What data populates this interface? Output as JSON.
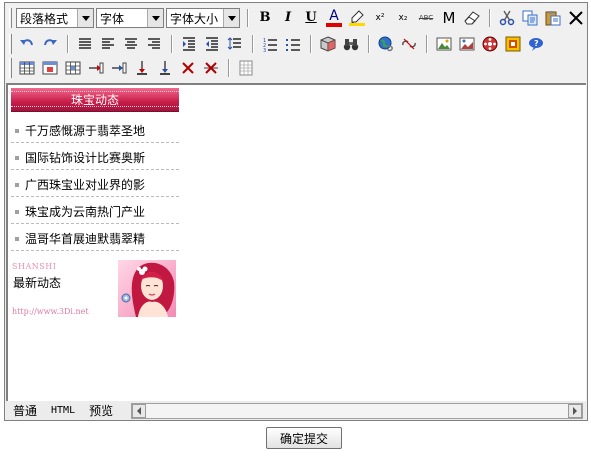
{
  "toolbar": {
    "paragraph_format": "段落格式",
    "font_family": "字体",
    "font_size": "字体大小",
    "bold_label": "B",
    "italic_label": "I",
    "underline_label": "U",
    "font_color_label": "A",
    "superscript_label": "x²",
    "subscript_label": "x₂",
    "spellcheck_label": "ABC",
    "marker_label": "M"
  },
  "content": {
    "news_header": "珠宝动态",
    "news_items": [
      "千万感慨源于翡萃圣地",
      "国际钻饰设计比赛奥斯",
      "广西珠宝业对业界的影",
      "珠宝成为云南热门产业",
      "温哥华首展迪默翡翠精"
    ],
    "banner": {
      "brand": "SHANSHI",
      "text": "最新动态",
      "url": "http://www.3Di.net"
    }
  },
  "tabs": [
    "普通",
    "HTML",
    "预览"
  ],
  "submit_label": "确定提交",
  "colors": {
    "header_red": "#c81e4a",
    "font_color_bar": "#e00000",
    "highlight_bar": "#ffd800"
  }
}
